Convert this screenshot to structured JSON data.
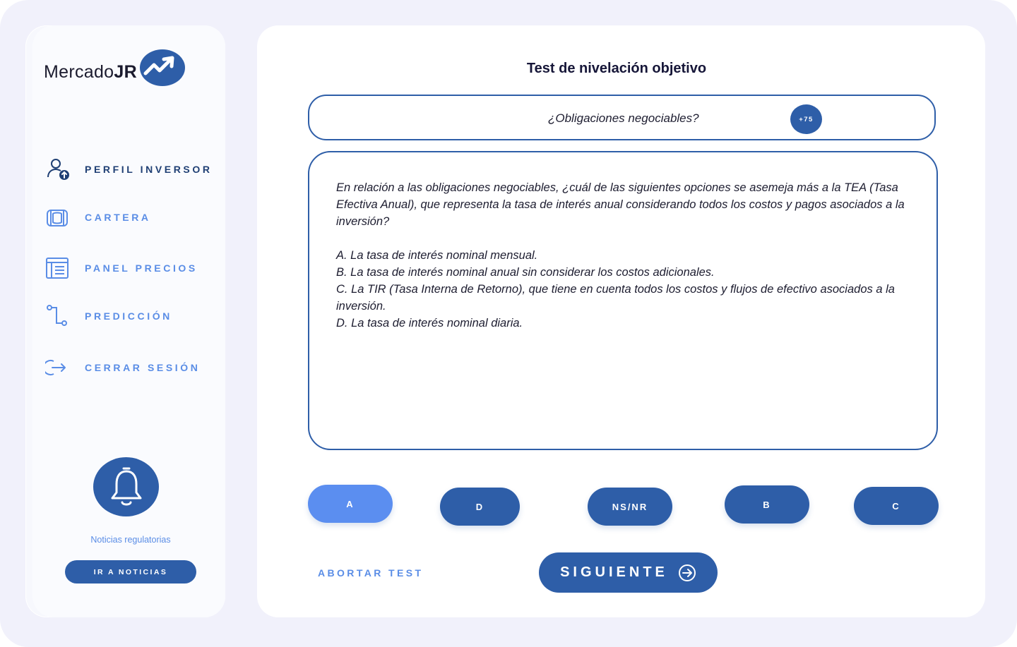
{
  "brand": {
    "name_regular": "Mercado",
    "name_bold": "JR"
  },
  "sidebar": {
    "items": [
      {
        "label": "PERFIL INVERSOR",
        "icon": "user-upload-icon",
        "active": true
      },
      {
        "label": "CARTERA",
        "icon": "wallet-icon",
        "active": false
      },
      {
        "label": "PANEL PRECIOS",
        "icon": "price-panel-icon",
        "active": false
      },
      {
        "label": "PREDICCIÓN",
        "icon": "prediction-icon",
        "active": false
      },
      {
        "label": "CERRAR SESIÓN",
        "icon": "logout-icon",
        "active": false
      }
    ],
    "news": {
      "icon": "bell-icon",
      "text": "Noticias regulatorias",
      "button_label": "IR A NOTICIAS"
    }
  },
  "main": {
    "title": "Test de nivelación objetivo",
    "topic": "¿Obligaciones negociables?",
    "points_badge": "+75",
    "question": {
      "prompt": "En relación a las obligaciones negociables, ¿cuál de las siguientes opciones se asemeja más a la TEA (Tasa Efectiva Anual), que representa la tasa de interés anual considerando todos los costos y pagos asociados a la inversión?",
      "options": [
        "A. La tasa de interés nominal mensual.",
        "B. La tasa de interés nominal anual sin considerar los costos adicionales.",
        "C. La TIR (Tasa Interna de Retorno), que tiene en cuenta todos los costos y flujos de efectivo asociados a la inversión.",
        "D. La tasa de interés nominal diaria."
      ]
    },
    "answers": [
      "A",
      "D",
      "NS/NR",
      "B",
      "C"
    ],
    "selected_answer": "A",
    "abort_label": "ABORTAR TEST",
    "next_label": "SIGUIENTE"
  },
  "colors": {
    "primary": "#2e5ea8",
    "accent": "#5a8de6",
    "selected": "#5b8ef0",
    "background": "#f1f1fb"
  }
}
